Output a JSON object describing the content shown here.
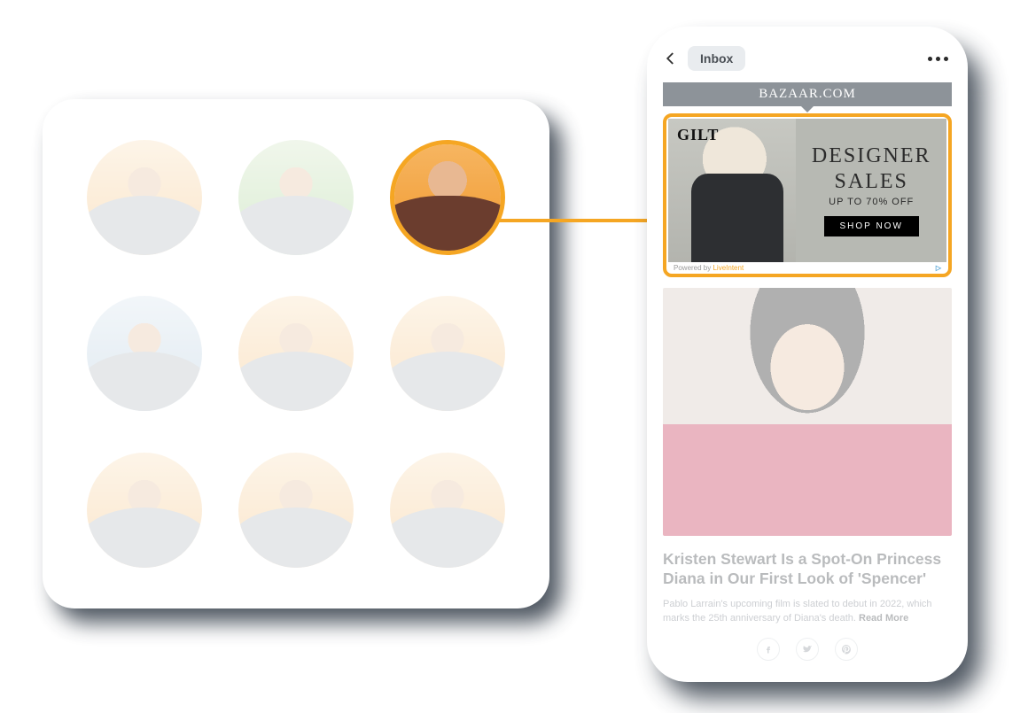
{
  "avatars": {
    "selected_index": 2,
    "items": [
      {
        "name": "person-1"
      },
      {
        "name": "person-2"
      },
      {
        "name": "person-3"
      },
      {
        "name": "person-4"
      },
      {
        "name": "person-5"
      },
      {
        "name": "person-6"
      },
      {
        "name": "person-7"
      },
      {
        "name": "person-8"
      },
      {
        "name": "person-9"
      }
    ]
  },
  "phone": {
    "header": {
      "inbox_label": "Inbox"
    },
    "publisher_label": "BAZAAR.COM",
    "ad": {
      "brand": "GILT",
      "headline_line1": "DESIGNER",
      "headline_line2": "SALES",
      "subline": "UP TO 70% OFF",
      "cta": "SHOP NOW",
      "powered_by_prefix": "Powered by ",
      "powered_by_brand": "LiveIntent",
      "adchoices": "▷"
    },
    "article": {
      "title": "Kristen Stewart Is a Spot-On Princess Diana in Our First Look of 'Spencer'",
      "body": "Pablo Larrain's upcoming film is slated to debut in 2022, which marks the 25th anniversary of Diana's death. ",
      "read_more": "Read More"
    }
  },
  "colors": {
    "accent": "#f5a623"
  }
}
